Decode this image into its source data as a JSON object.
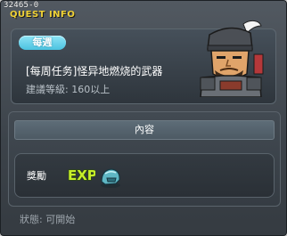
{
  "quest_id": "32465-0",
  "window_title": "QUEST INFO",
  "quest": {
    "frequency_badge": "每週",
    "name": "[每周任务]怪异地燃烧的武器",
    "level_requirement": "建議等級: 160以上"
  },
  "content": {
    "header": "內容",
    "reward_label": "獎勵",
    "rewards": [
      {
        "type": "exp",
        "icon": "exp-icon"
      },
      {
        "type": "item",
        "icon": "helmet-item-icon"
      }
    ]
  },
  "status": "狀態:  可開始",
  "colors": {
    "title": "#f0d236",
    "badge": "#5ccbe6",
    "exp_text": "#c6ee2a"
  }
}
